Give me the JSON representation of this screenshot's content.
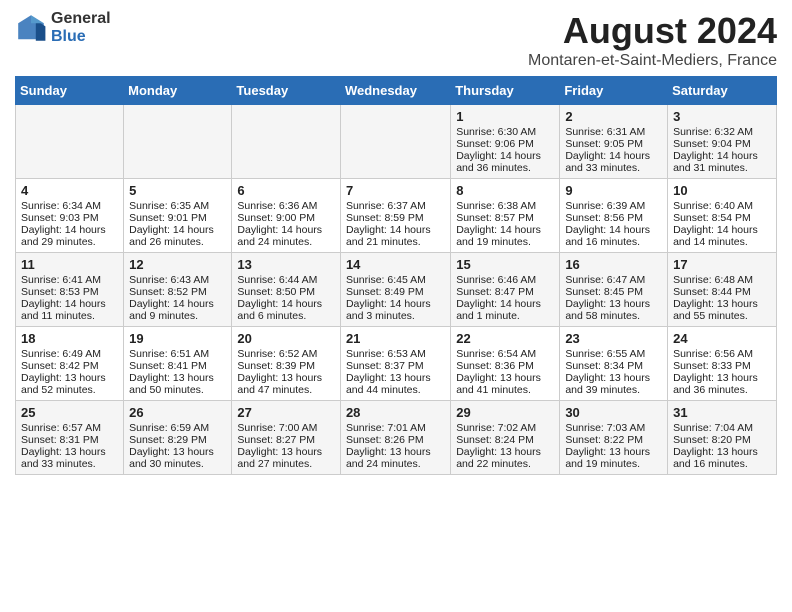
{
  "logo": {
    "general": "General",
    "blue": "Blue"
  },
  "header": {
    "title": "August 2024",
    "location": "Montaren-et-Saint-Mediers, France"
  },
  "days": [
    "Sunday",
    "Monday",
    "Tuesday",
    "Wednesday",
    "Thursday",
    "Friday",
    "Saturday"
  ],
  "weeks": [
    [
      {
        "day": "",
        "info": ""
      },
      {
        "day": "",
        "info": ""
      },
      {
        "day": "",
        "info": ""
      },
      {
        "day": "",
        "info": ""
      },
      {
        "day": "1",
        "info": "Sunrise: 6:30 AM\nSunset: 9:06 PM\nDaylight: 14 hours\nand 36 minutes."
      },
      {
        "day": "2",
        "info": "Sunrise: 6:31 AM\nSunset: 9:05 PM\nDaylight: 14 hours\nand 33 minutes."
      },
      {
        "day": "3",
        "info": "Sunrise: 6:32 AM\nSunset: 9:04 PM\nDaylight: 14 hours\nand 31 minutes."
      }
    ],
    [
      {
        "day": "4",
        "info": "Sunrise: 6:34 AM\nSunset: 9:03 PM\nDaylight: 14 hours\nand 29 minutes."
      },
      {
        "day": "5",
        "info": "Sunrise: 6:35 AM\nSunset: 9:01 PM\nDaylight: 14 hours\nand 26 minutes."
      },
      {
        "day": "6",
        "info": "Sunrise: 6:36 AM\nSunset: 9:00 PM\nDaylight: 14 hours\nand 24 minutes."
      },
      {
        "day": "7",
        "info": "Sunrise: 6:37 AM\nSunset: 8:59 PM\nDaylight: 14 hours\nand 21 minutes."
      },
      {
        "day": "8",
        "info": "Sunrise: 6:38 AM\nSunset: 8:57 PM\nDaylight: 14 hours\nand 19 minutes."
      },
      {
        "day": "9",
        "info": "Sunrise: 6:39 AM\nSunset: 8:56 PM\nDaylight: 14 hours\nand 16 minutes."
      },
      {
        "day": "10",
        "info": "Sunrise: 6:40 AM\nSunset: 8:54 PM\nDaylight: 14 hours\nand 14 minutes."
      }
    ],
    [
      {
        "day": "11",
        "info": "Sunrise: 6:41 AM\nSunset: 8:53 PM\nDaylight: 14 hours\nand 11 minutes."
      },
      {
        "day": "12",
        "info": "Sunrise: 6:43 AM\nSunset: 8:52 PM\nDaylight: 14 hours\nand 9 minutes."
      },
      {
        "day": "13",
        "info": "Sunrise: 6:44 AM\nSunset: 8:50 PM\nDaylight: 14 hours\nand 6 minutes."
      },
      {
        "day": "14",
        "info": "Sunrise: 6:45 AM\nSunset: 8:49 PM\nDaylight: 14 hours\nand 3 minutes."
      },
      {
        "day": "15",
        "info": "Sunrise: 6:46 AM\nSunset: 8:47 PM\nDaylight: 14 hours\nand 1 minute."
      },
      {
        "day": "16",
        "info": "Sunrise: 6:47 AM\nSunset: 8:45 PM\nDaylight: 13 hours\nand 58 minutes."
      },
      {
        "day": "17",
        "info": "Sunrise: 6:48 AM\nSunset: 8:44 PM\nDaylight: 13 hours\nand 55 minutes."
      }
    ],
    [
      {
        "day": "18",
        "info": "Sunrise: 6:49 AM\nSunset: 8:42 PM\nDaylight: 13 hours\nand 52 minutes."
      },
      {
        "day": "19",
        "info": "Sunrise: 6:51 AM\nSunset: 8:41 PM\nDaylight: 13 hours\nand 50 minutes."
      },
      {
        "day": "20",
        "info": "Sunrise: 6:52 AM\nSunset: 8:39 PM\nDaylight: 13 hours\nand 47 minutes."
      },
      {
        "day": "21",
        "info": "Sunrise: 6:53 AM\nSunset: 8:37 PM\nDaylight: 13 hours\nand 44 minutes."
      },
      {
        "day": "22",
        "info": "Sunrise: 6:54 AM\nSunset: 8:36 PM\nDaylight: 13 hours\nand 41 minutes."
      },
      {
        "day": "23",
        "info": "Sunrise: 6:55 AM\nSunset: 8:34 PM\nDaylight: 13 hours\nand 39 minutes."
      },
      {
        "day": "24",
        "info": "Sunrise: 6:56 AM\nSunset: 8:33 PM\nDaylight: 13 hours\nand 36 minutes."
      }
    ],
    [
      {
        "day": "25",
        "info": "Sunrise: 6:57 AM\nSunset: 8:31 PM\nDaylight: 13 hours\nand 33 minutes."
      },
      {
        "day": "26",
        "info": "Sunrise: 6:59 AM\nSunset: 8:29 PM\nDaylight: 13 hours\nand 30 minutes."
      },
      {
        "day": "27",
        "info": "Sunrise: 7:00 AM\nSunset: 8:27 PM\nDaylight: 13 hours\nand 27 minutes."
      },
      {
        "day": "28",
        "info": "Sunrise: 7:01 AM\nSunset: 8:26 PM\nDaylight: 13 hours\nand 24 minutes."
      },
      {
        "day": "29",
        "info": "Sunrise: 7:02 AM\nSunset: 8:24 PM\nDaylight: 13 hours\nand 22 minutes."
      },
      {
        "day": "30",
        "info": "Sunrise: 7:03 AM\nSunset: 8:22 PM\nDaylight: 13 hours\nand 19 minutes."
      },
      {
        "day": "31",
        "info": "Sunrise: 7:04 AM\nSunset: 8:20 PM\nDaylight: 13 hours\nand 16 minutes."
      }
    ]
  ]
}
